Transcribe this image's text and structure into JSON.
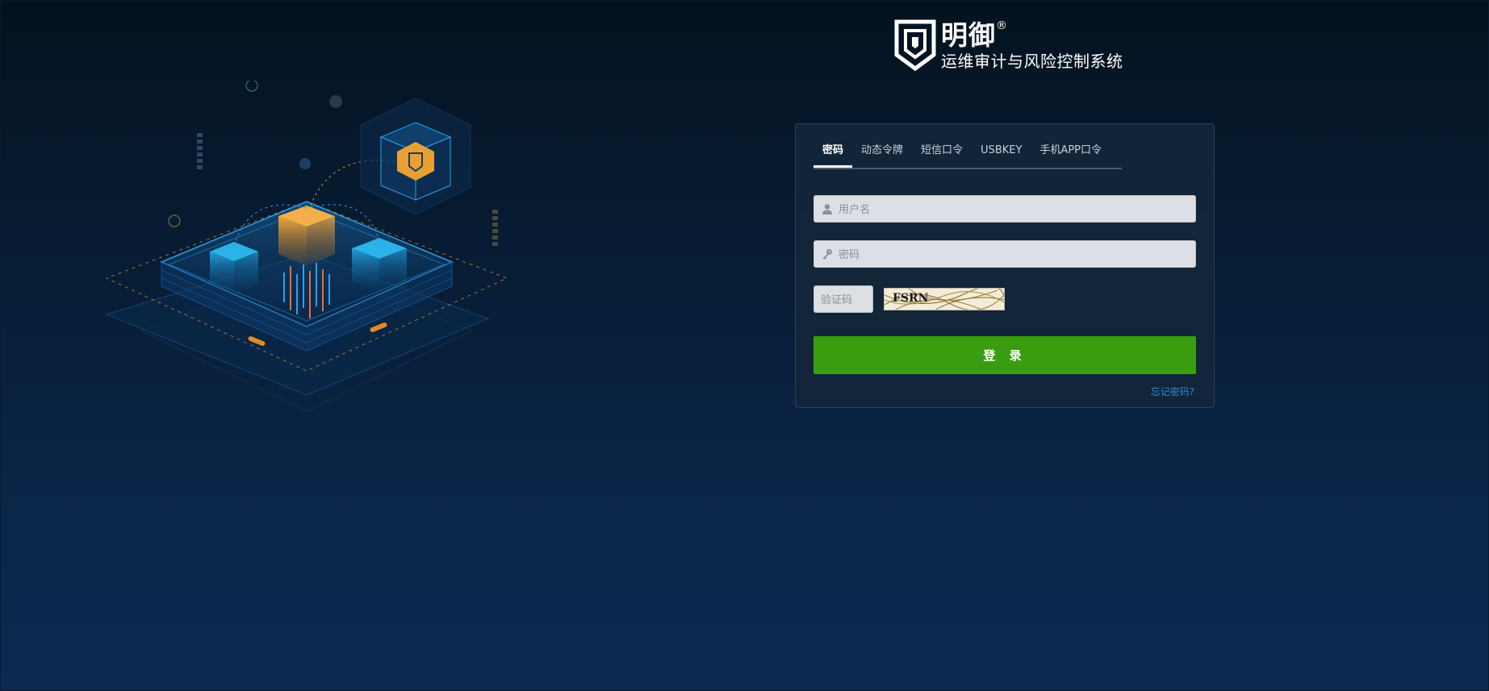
{
  "logo": {
    "brand": "明御",
    "registered": "®",
    "subtitle": "运维审计与风险控制系统",
    "icon": "shield-logo-icon"
  },
  "tabs": [
    {
      "label": "密码",
      "active": true
    },
    {
      "label": "动态令牌",
      "active": false
    },
    {
      "label": "短信口令",
      "active": false
    },
    {
      "label": "USBKEY",
      "active": false
    },
    {
      "label": "手机APP口令",
      "active": false
    }
  ],
  "form": {
    "username_placeholder": "用户名",
    "password_placeholder": "密码",
    "captcha_placeholder": "验证码",
    "captcha_image_text": "FSRN",
    "login_label": "登 录",
    "forgot_label": "忘记密码?"
  },
  "colors": {
    "accent_green": "#3a9d0f",
    "link_blue": "#2a8bd8",
    "cube_orange": "#e8a033",
    "glow_blue": "#1aa7e0"
  }
}
